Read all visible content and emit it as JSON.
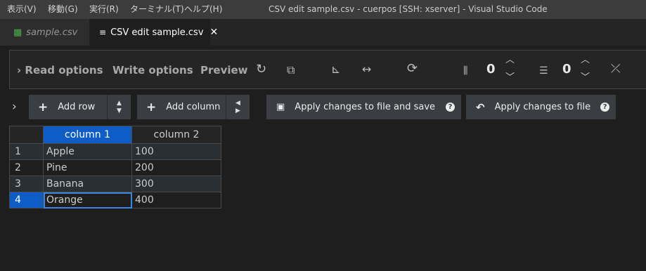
{
  "menubar": {
    "items": [
      "表示(V)",
      "移動(G)",
      "実行(R)",
      "ターミナル(T)",
      "ヘルプ(H)"
    ],
    "window_title": "CSV edit sample.csv - cuerpos [SSH: xserver] - Visual Studio Code"
  },
  "tabs": [
    {
      "label": "sample.csv",
      "icon": "table-file-icon",
      "active": false
    },
    {
      "label": "CSV edit sample.csv",
      "icon": "lines-icon",
      "active": true,
      "close": "✕"
    }
  ],
  "options_panel": {
    "read_options": "Read options",
    "write_options": "Write options",
    "preview": "Preview",
    "fixed_rows_count": "0",
    "fixed_columns_count": "0"
  },
  "toolbar": {
    "add_row": "Add row",
    "add_column": "Add column",
    "apply_save": "Apply changes to file and save",
    "apply": "Apply changes to file",
    "help_glyph": "?"
  },
  "table": {
    "headers": [
      "column 1",
      "column 2"
    ],
    "selected_header_index": 0,
    "rows": [
      {
        "num": "1",
        "cells": [
          "Apple",
          "100"
        ]
      },
      {
        "num": "2",
        "cells": [
          "Pine",
          "200"
        ]
      },
      {
        "num": "3",
        "cells": [
          "Banana",
          "300"
        ]
      },
      {
        "num": "4",
        "cells": [
          "Orange",
          "400"
        ]
      }
    ],
    "selected_row_index": 3
  },
  "colors": {
    "accent": "#0e5dc6",
    "background": "#1e1e1e",
    "button": "#3a3d41"
  }
}
